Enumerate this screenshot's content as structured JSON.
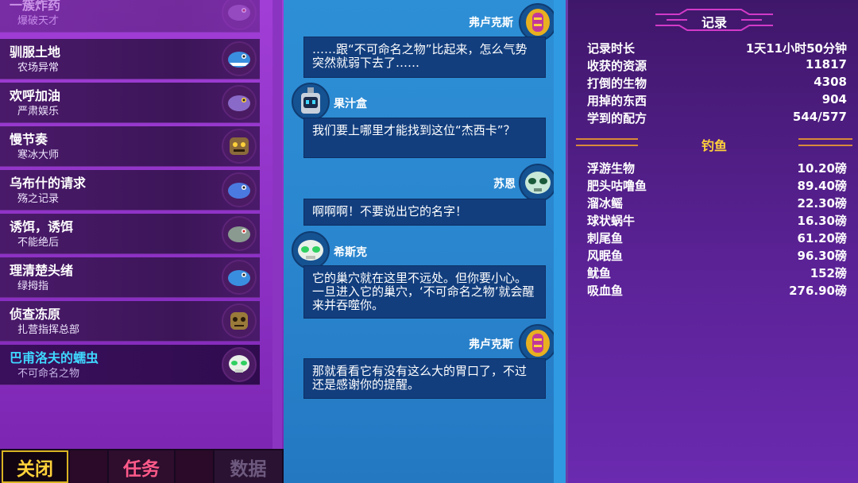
{
  "quests": [
    {
      "title": "一簇炸药",
      "subtitle": "爆破天才",
      "icon": "fish-purple-icon"
    },
    {
      "title": "驯服土地",
      "subtitle": "农场异常",
      "icon": "fish-blue-icon"
    },
    {
      "title": "欢呼加油",
      "subtitle": "严肃娱乐",
      "icon": "fish-purple-icon"
    },
    {
      "title": "慢节奏",
      "subtitle": "寒冰大师",
      "icon": "monster-face-icon"
    },
    {
      "title": "乌布什的请求",
      "subtitle": "殇之记录",
      "icon": "fish-blue-icon"
    },
    {
      "title": "诱饵，诱饵",
      "subtitle": "不能绝后",
      "icon": "fish-grey-icon"
    },
    {
      "title": "理清楚头绪",
      "subtitle": "绿拇指",
      "icon": "fish-blue-icon"
    },
    {
      "title": "侦查冻原",
      "subtitle": "扎营指挥总部",
      "icon": "mask-icon"
    },
    {
      "title": "巴甫洛夫的蠕虫",
      "subtitle": "不可命名之物",
      "icon": "skull-icon"
    }
  ],
  "tabs": {
    "close": "关闭",
    "quests": "任务",
    "data": "数据"
  },
  "dialogue": [
    {
      "speaker": "弗卢克斯",
      "text": "……跟“不可命名之物”比起来，怎么气势突然就弱下去了……",
      "avatar": "flux-avatar-icon"
    },
    {
      "speaker": "果汁盒",
      "text": "我们要上哪里才能找到这位“杰西卡”？",
      "avatar": "juicebox-avatar-icon"
    },
    {
      "speaker": "苏恩",
      "text": "啊啊啊！不要说出它的名字！",
      "avatar": "sune-avatar-icon"
    },
    {
      "speaker": "希斯克",
      "text": "它的巢穴就在这里不远处。但你要小心。一旦进入它的巢穴，‘不可命名之物’就会醒来并吞噬你。",
      "avatar": "hiske-avatar-icon"
    },
    {
      "speaker": "弗卢克斯",
      "text": "那就看看它有没有这么大的胃口了，不过还是感谢你的提醒。",
      "avatar": "flux-avatar-icon"
    }
  ],
  "records": {
    "title": "记录",
    "rows": [
      {
        "label": "记录时长",
        "value": "1天11小时50分钟"
      },
      {
        "label": "收获的资源",
        "value": "11817"
      },
      {
        "label": "打倒的生物",
        "value": "4308"
      },
      {
        "label": "用掉的东西",
        "value": "904"
      },
      {
        "label": "学到的配方",
        "value": "544/577"
      }
    ]
  },
  "fishing": {
    "title": "钓鱼",
    "rows": [
      {
        "label": "浮游生物",
        "value": "10.20磅"
      },
      {
        "label": "肥头咕噜鱼",
        "value": "89.40磅"
      },
      {
        "label": "溜冰鳐",
        "value": "22.30磅"
      },
      {
        "label": "球状蜗牛",
        "value": "16.30磅"
      },
      {
        "label": "刺尾鱼",
        "value": "61.20磅"
      },
      {
        "label": "风眠鱼",
        "value": "96.30磅"
      },
      {
        "label": "鱿鱼",
        "value": "152磅"
      },
      {
        "label": "吸血鱼",
        "value": "276.90磅"
      }
    ]
  },
  "colors": {
    "active_quest": "#3fd7ff",
    "close_tab": "#ffd23a",
    "quests_tab": "#ff5a8a",
    "fishing_title": "#ffd23a"
  }
}
